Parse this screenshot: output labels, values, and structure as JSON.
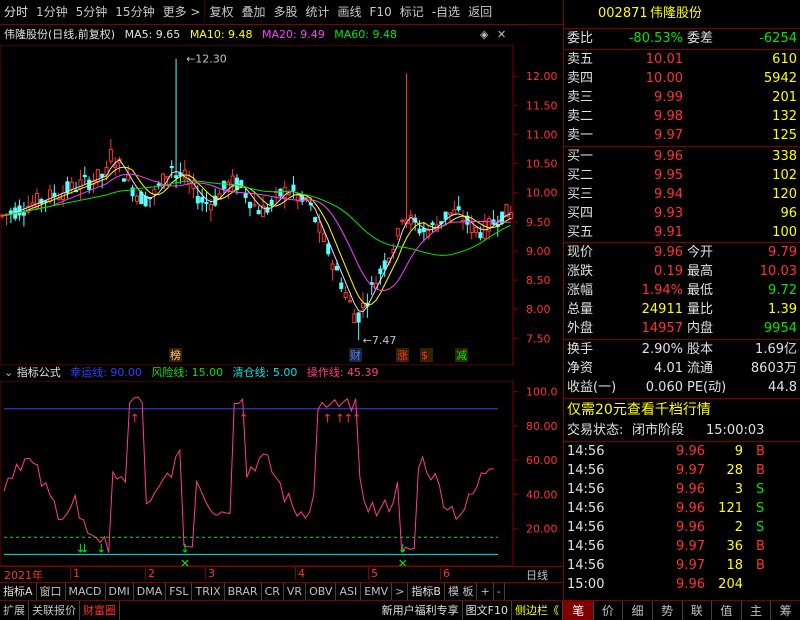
{
  "toolbar": {
    "items": [
      "分时",
      "1分钟",
      "5分钟",
      "15分钟",
      "更多 >",
      "复权",
      "叠加",
      "多股",
      "统计",
      "画线",
      "F10",
      "标记",
      "-自选",
      "返回"
    ]
  },
  "chart_header": {
    "name": "伟隆股份(日线,前复权)",
    "ma5": "MA5: 9.65",
    "ma10": "MA10: 9.48",
    "ma20": "MA20: 9.49",
    "ma60": "MA60: 9.48"
  },
  "price_axis": [
    "12.00",
    "11.50",
    "11.00",
    "10.50",
    "10.00",
    "9.50",
    "9.00",
    "8.50",
    "8.00",
    "7.50"
  ],
  "annotations": {
    "high": "12.30",
    "low": "7.47",
    "markers": [
      "榜",
      "财",
      "涨",
      "$",
      "减"
    ]
  },
  "indicator_header": {
    "name": "指标公式",
    "l1": "幸运线: 90.00",
    "l2": "风险线: 15.00",
    "l3": "清仓线: 5.00",
    "l4": "操作线: 45.39"
  },
  "indicator_axis": [
    "100.0",
    "80.00",
    "60.00",
    "40.00",
    "20.00"
  ],
  "time_axis": {
    "year": "2021年",
    "months": [
      "1",
      "2",
      "3",
      "4",
      "5",
      "6"
    ],
    "period": "日线"
  },
  "indicator_tabs": [
    "指标A",
    "窗口",
    "MACD",
    "DMI",
    "DMA",
    "FSL",
    "TRIX",
    "BRAR",
    "CR",
    "VR",
    "OBV",
    "ASI",
    "EMV",
    ">",
    "指标B",
    "模 板",
    "+",
    "-"
  ],
  "bottom_bar": {
    "left": [
      "扩展",
      "关联报价",
      "财富圈"
    ],
    "right": [
      "新用户福利专享",
      "图文F10",
      "侧边栏《"
    ]
  },
  "quote": {
    "code": "002871",
    "name": "伟隆股份",
    "weibi_label": "委比",
    "weibi": "-80.53%",
    "weicha_label": "委差",
    "weicha": "-6254",
    "asks": [
      {
        "label": "卖五",
        "price": "10.01",
        "vol": "610"
      },
      {
        "label": "卖四",
        "price": "10.00",
        "vol": "5942"
      },
      {
        "label": "卖三",
        "price": "9.99",
        "vol": "201"
      },
      {
        "label": "卖二",
        "price": "9.98",
        "vol": "132"
      },
      {
        "label": "卖一",
        "price": "9.97",
        "vol": "125"
      }
    ],
    "bids": [
      {
        "label": "买一",
        "price": "9.96",
        "vol": "338"
      },
      {
        "label": "买二",
        "price": "9.95",
        "vol": "102"
      },
      {
        "label": "买三",
        "price": "9.94",
        "vol": "120"
      },
      {
        "label": "买四",
        "price": "9.93",
        "vol": "96"
      },
      {
        "label": "买五",
        "price": "9.91",
        "vol": "100"
      }
    ],
    "stats": [
      {
        "l1": "现价",
        "v1": "9.96",
        "l2": "今开",
        "v2": "9.79"
      },
      {
        "l1": "涨跌",
        "v1": "0.19",
        "l2": "最高",
        "v2": "10.03"
      },
      {
        "l1": "涨幅",
        "v1": "1.94%",
        "l2": "最低",
        "v2": "9.72"
      },
      {
        "l1": "总量",
        "v1": "24911",
        "l2": "量比",
        "v2": "1.39"
      },
      {
        "l1": "外盘",
        "v1": "14957",
        "l2": "内盘",
        "v2": "9954"
      }
    ],
    "stats2": [
      {
        "l1": "换手",
        "v1": "2.90%",
        "l2": "股本",
        "v2": "1.69亿"
      },
      {
        "l1": "净资",
        "v1": "4.01",
        "l2": "流通",
        "v2": "8603万"
      },
      {
        "l1": "收益(一)",
        "v1": "0.060",
        "l2": "PE(动)",
        "v2": "44.8"
      }
    ],
    "promo": "仅需20元查看千档行情",
    "status_label": "交易状态:",
    "status": "闭市阶段",
    "status_time": "15:00:03",
    "trades": [
      {
        "t": "14:56",
        "p": "9.96",
        "v": "9",
        "s": "B"
      },
      {
        "t": "14:56",
        "p": "9.97",
        "v": "28",
        "s": "B"
      },
      {
        "t": "14:56",
        "p": "9.96",
        "v": "3",
        "s": "S"
      },
      {
        "t": "14:56",
        "p": "9.96",
        "v": "121",
        "s": "S"
      },
      {
        "t": "14:56",
        "p": "9.96",
        "v": "2",
        "s": "S"
      },
      {
        "t": "14:56",
        "p": "9.97",
        "v": "36",
        "s": "B"
      },
      {
        "t": "14:56",
        "p": "9.97",
        "v": "18",
        "s": "B"
      },
      {
        "t": "15:00",
        "p": "9.96",
        "v": "204",
        "s": ""
      }
    ],
    "tabs": [
      "笔",
      "价",
      "细",
      "势",
      "联",
      "值",
      "主",
      "筹"
    ]
  }
}
